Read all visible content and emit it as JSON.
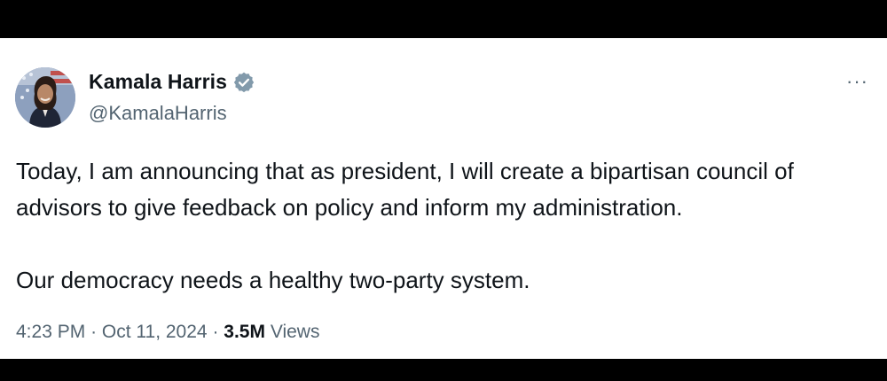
{
  "author": {
    "display_name": "Kamala Harris",
    "handle": "@KamalaHarris",
    "verified": true,
    "avatar_icon": "profile-photo"
  },
  "tweet": {
    "paragraphs": [
      "Today, I am announcing that as president, I will create a bipartisan council of advisors to give feedback on policy and inform my administration.",
      "Our democracy needs a healthy two-party system."
    ],
    "time": "4:23 PM",
    "separator": "·",
    "date": "Oct 11, 2024",
    "views_count": "3.5M",
    "views_label": "Views"
  },
  "menu": {
    "more_label": "···"
  },
  "colors": {
    "text_primary": "#0f1419",
    "text_secondary": "#536471",
    "verified_badge": "#829aab",
    "letterbox": "#000000",
    "card_background": "#ffffff"
  }
}
